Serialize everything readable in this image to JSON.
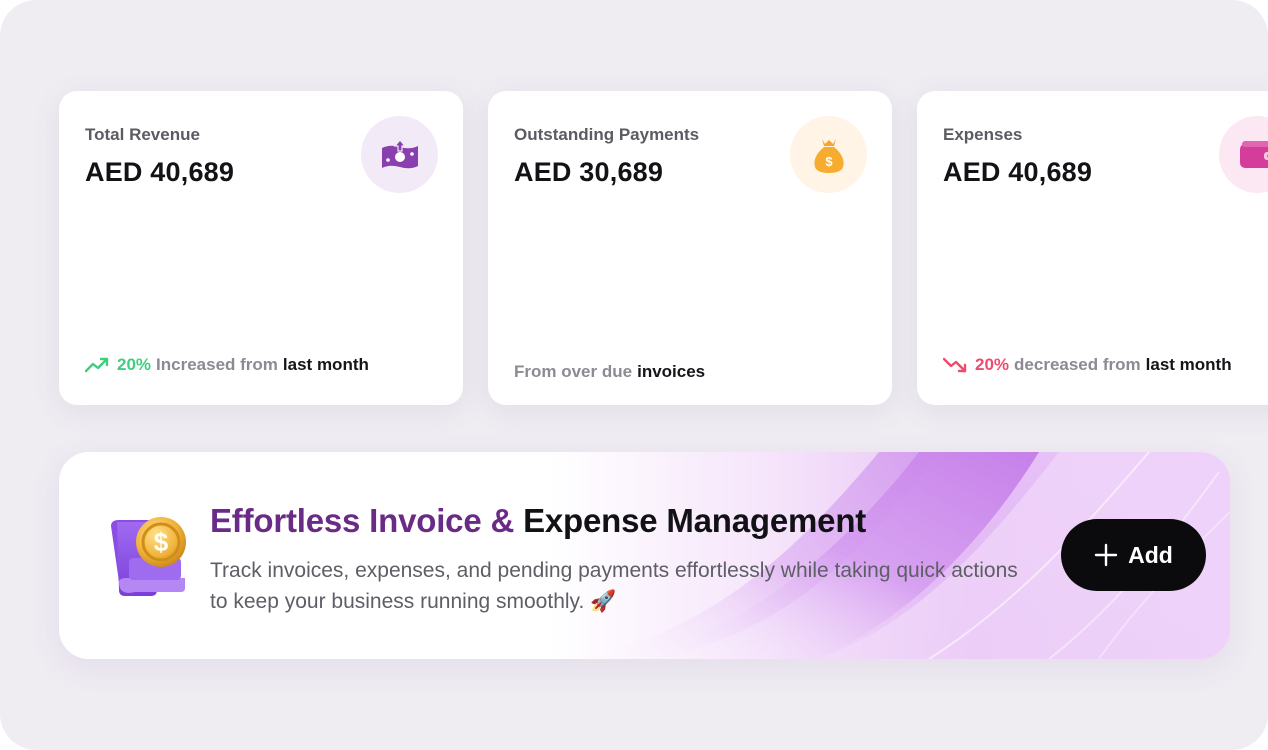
{
  "colors": {
    "background": "#efecf2",
    "card": "#ffffff",
    "trend_up": "#3fce7d",
    "trend_down": "#ee4a6e",
    "brand_purple": "#6a2b86",
    "button": "#0b0b0d"
  },
  "cards": [
    {
      "title": "Total Revenue",
      "value": "AED 40,689",
      "icon": "revenue-upload-icon",
      "footer": {
        "trend": "up",
        "percent": "20%",
        "text": "Increased from",
        "emphasis": "last month"
      }
    },
    {
      "title": "Outstanding Payments",
      "value": "AED 30,689",
      "icon": "money-bag-icon",
      "footer": {
        "text": "From over due",
        "emphasis": "invoices"
      }
    },
    {
      "title": "Expenses",
      "value": "AED 40,689",
      "icon": "wallet-icon",
      "footer": {
        "trend": "down",
        "percent": "20%",
        "text": "decreased from",
        "emphasis": "last month"
      }
    }
  ],
  "banner": {
    "title_part1": "Effortless Invoice &",
    "title_part2": "Expense Management",
    "description": "Track invoices, expenses, and pending payments effortlessly while taking quick actions to keep your business running smoothly. 🚀",
    "illustration": "invoice-scroll-coin-icon",
    "button": {
      "icon": "plus-icon",
      "label": "Add"
    }
  }
}
